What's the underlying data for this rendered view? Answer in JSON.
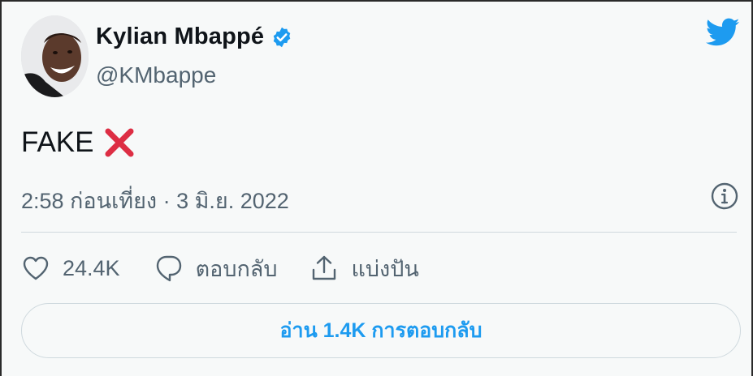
{
  "author": {
    "name": "Kylian Mbappé",
    "handle": "@KMbappe",
    "verified": true
  },
  "tweet": {
    "text": "FAKE",
    "emoji_icon": "cross-mark-icon",
    "timestamp": "2:58 ก่อนเที่ยง · 3 มิ.ย. 2022"
  },
  "actions": {
    "like_count": "24.4K",
    "reply_label": "ตอบกลับ",
    "share_label": "แบ่งปัน"
  },
  "read_replies_label": "อ่าน 1.4K การตอบกลับ",
  "icons": {
    "logo": "twitter-bird-icon",
    "verified": "verified-badge-icon",
    "info": "info-icon",
    "like": "heart-icon",
    "reply": "reply-bubble-icon",
    "share": "share-icon"
  },
  "colors": {
    "brand": "#1d9bf0",
    "text_primary": "#0f1419",
    "text_secondary": "#536471",
    "border": "#cfd9de",
    "cross_red": "#dd2e44",
    "background": "#f7f9f9"
  }
}
